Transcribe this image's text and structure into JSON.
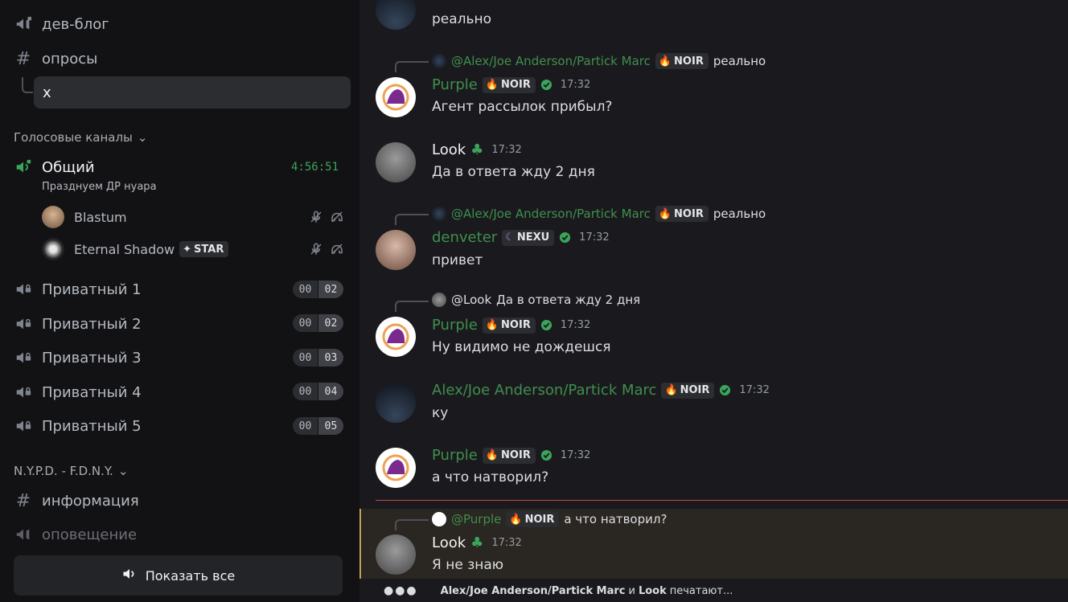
{
  "sidebar": {
    "channels_top": [
      {
        "name": "дев-блог",
        "icon": "megaphone-icon"
      },
      {
        "name": "опросы",
        "icon": "hash-icon"
      }
    ],
    "thread": {
      "name": "x"
    },
    "voice_category": "Голосовые каналы",
    "voice_main": {
      "name": "Общий",
      "timer": "4:56:51",
      "status": "Празднуем ДР нуара",
      "users": [
        {
          "name": "Blastum",
          "icon": "cat-avatar"
        },
        {
          "name": "Eternal Shadow",
          "badge": "STAR"
        }
      ]
    },
    "private_channels": [
      {
        "name": "Приватный 1",
        "a": "00",
        "b": "02"
      },
      {
        "name": "Приватный 2",
        "a": "00",
        "b": "02"
      },
      {
        "name": "Приватный 3",
        "a": "00",
        "b": "03"
      },
      {
        "name": "Приватный 4",
        "a": "00",
        "b": "04"
      },
      {
        "name": "Приватный 5",
        "a": "00",
        "b": "05"
      }
    ],
    "category2": "N.Y.P.D. - F.D.N.Y.",
    "channels_bottom": [
      {
        "name": "информация",
        "icon": "hash-icon"
      },
      {
        "name": "оповещение",
        "icon": "megaphone-icon"
      }
    ],
    "show_all": "Показать все"
  },
  "chat": {
    "top_text": "реально",
    "messages": [
      {
        "ref_user": "@Alex/Joe Anderson/Partick Marc",
        "ref_tag": "NOIR",
        "ref_text": "реально",
        "user": "Purple",
        "tag": "NOIR",
        "time": "17:32",
        "text": "Агент рассылок прибыл?"
      },
      {
        "user": "Look",
        "time": "17:32",
        "text": "Да в ответа жду 2 дня"
      },
      {
        "ref_user": "@Alex/Joe Anderson/Partick Marc",
        "ref_tag": "NOIR",
        "ref_text": "реально",
        "user": "denveter",
        "tag": "NEXU",
        "time": "17:32",
        "text": "привет"
      },
      {
        "ref_user": "@Look",
        "ref_text": "Да в ответа жду 2 дня",
        "user": "Purple",
        "tag": "NOIR",
        "time": "17:32",
        "text": "Ну видимо не дождешся"
      },
      {
        "user": "Alex/Joe Anderson/Partick Marc",
        "tag": "NOIR",
        "time": "17:32",
        "text": "ку"
      },
      {
        "user": "Purple",
        "tag": "NOIR",
        "time": "17:32",
        "text": "а что натворил?"
      },
      {
        "ref_user": "@Purple",
        "ref_tag": "NOIR",
        "ref_text": "а что натворил?",
        "user": "Look",
        "time": "17:32",
        "text": "Я не знаю"
      }
    ],
    "typing": {
      "user1": "Alex/Joe Anderson/Partick Marc",
      "and": "и",
      "user2": "Look",
      "suffix": "печатают..."
    }
  }
}
